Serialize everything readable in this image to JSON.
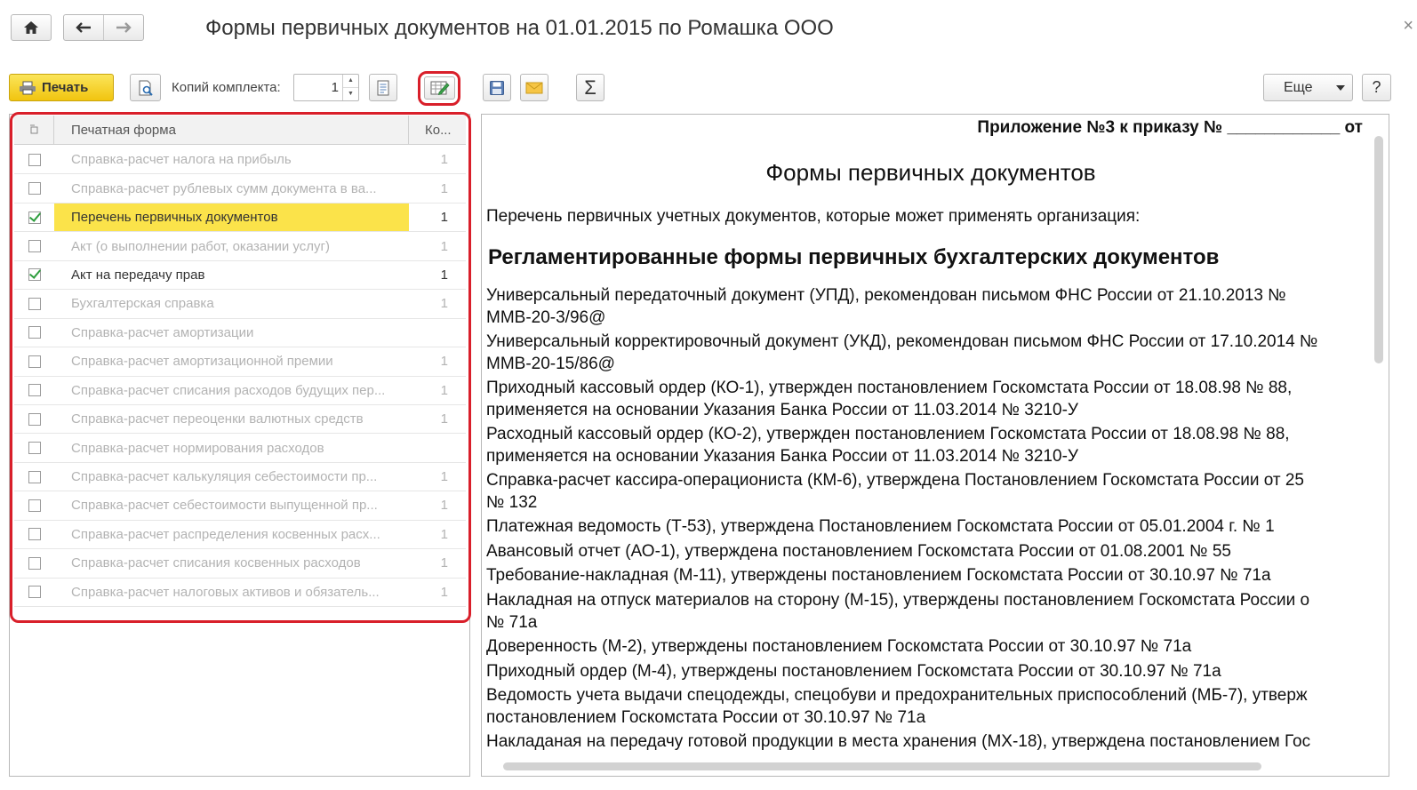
{
  "window": {
    "title": "Формы первичных документов на 01.01.2015 по Ромашка ООО",
    "close_glyph": "×"
  },
  "toolbar": {
    "print_label": "Печать",
    "copies_label": "Копий комплекта:",
    "copies_value": "1",
    "more_label": "Еще",
    "help_label": "?",
    "sum_glyph": "Σ"
  },
  "list": {
    "headers": {
      "name": "Печатная форма",
      "count": "Ко..."
    },
    "rows": [
      {
        "checked": false,
        "selected": false,
        "name": "Справка-расчет налога на прибыль",
        "count": "1"
      },
      {
        "checked": false,
        "selected": false,
        "name": "Справка-расчет рублевых сумм документа в ва...",
        "count": "1"
      },
      {
        "checked": true,
        "selected": true,
        "name": "Перечень первичных документов",
        "count": "1"
      },
      {
        "checked": false,
        "selected": false,
        "name": "Акт (о выполнении работ, оказании услуг)",
        "count": "1"
      },
      {
        "checked": true,
        "selected": false,
        "name": "Акт на передачу прав",
        "count": "1"
      },
      {
        "checked": false,
        "selected": false,
        "name": "Бухгалтерская справка",
        "count": "1"
      },
      {
        "checked": false,
        "selected": false,
        "name": "Справка-расчет амортизации",
        "count": ""
      },
      {
        "checked": false,
        "selected": false,
        "name": "Справка-расчет амортизационной премии",
        "count": "1"
      },
      {
        "checked": false,
        "selected": false,
        "name": "Справка-расчет списания расходов будущих пер...",
        "count": "1"
      },
      {
        "checked": false,
        "selected": false,
        "name": "Справка-расчет переоценки валютных средств",
        "count": "1"
      },
      {
        "checked": false,
        "selected": false,
        "name": "Справка-расчет нормирования расходов",
        "count": ""
      },
      {
        "checked": false,
        "selected": false,
        "name": "Справка-расчет калькуляция себестоимости пр...",
        "count": "1"
      },
      {
        "checked": false,
        "selected": false,
        "name": "Справка-расчет себестоимости выпущенной пр...",
        "count": "1"
      },
      {
        "checked": false,
        "selected": false,
        "name": "Справка-расчет распределения косвенных расх...",
        "count": "1"
      },
      {
        "checked": false,
        "selected": false,
        "name": "Справка-расчет списания косвенных расходов",
        "count": "1"
      },
      {
        "checked": false,
        "selected": false,
        "name": "Справка-расчет налоговых активов и обязатель...",
        "count": "1"
      }
    ]
  },
  "document": {
    "appendix": "Приложение №3 к приказу № ____________ от",
    "title": "Формы первичных документов",
    "intro": "Перечень первичных учетных документов, которые может применять организация:",
    "heading": "Регламентированные формы первичных бухгалтерских документов",
    "lines": [
      "Универсальный передаточный документ (УПД), рекомендован письмом ФНС России от 21.10.2013 №",
      "ММВ-20-3/96@",
      "Универсальный корректировочный документ (УКД), рекомендован письмом ФНС России от 17.10.2014 №",
      "ММВ-20-15/86@",
      "Приходный кассовый ордер (КО-1), утвержден постановлением Госкомстата России от 18.08.98 № 88,",
      "применяется на основании Указания Банка России от 11.03.2014 № 3210-У",
      "Расходный кассовый ордер (КО-2), утвержден постановлением Госкомстата России от 18.08.98 № 88,",
      "применяется на основании Указания Банка России от 11.03.2014 № 3210-У",
      "Справка-расчет кассира-операциониста (КМ-6), утверждена Постановлением Госкомстата России от 25",
      "№ 132",
      "Платежная ведомость (Т-53), утверждена Постановлением Госкомстата России от 05.01.2004 г. № 1",
      "Авансовый отчет (АО-1), утверждена постановлением Госкомстата России от  01.08.2001 № 55",
      "Требование-накладная (М-11), утверждены постановлением Госкомстата России от 30.10.97 № 71а",
      "Накладная на отпуск материалов на сторону (М-15), утверждены постановлением Госкомстата России о",
      "№ 71а",
      "Доверенность (М-2), утверждены постановлением Госкомстата России от 30.10.97 № 71а",
      "Приходный ордер (М-4), утверждены постановлением Госкомстата России от 30.10.97 № 71а",
      "Ведомость учета выдачи спецодежды, спецобуви и предохранительных приспособлений (МБ-7), утверж",
      "постановлением Госкомстата России от 30.10.97 № 71а",
      "Накладаная на передачу готовой продукции в места хранения (МХ-18), утверждена постановлением Гос"
    ]
  },
  "colors": {
    "accent_yellow": "#f1c40f",
    "selection_yellow": "#fbe34a",
    "highlight_red": "#d91f2a",
    "check_green": "#2e9e3e"
  }
}
